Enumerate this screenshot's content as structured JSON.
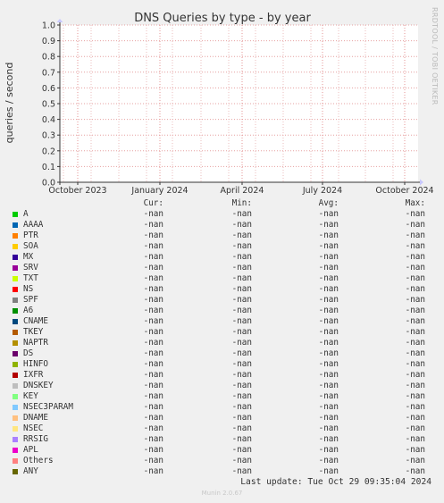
{
  "side_label": "RRDTOOL / TOBI OETIKER",
  "chart_data": {
    "type": "line",
    "title": "DNS Queries by type - by year",
    "ylabel": "queries / second",
    "xlabel": "",
    "ylim": [
      0,
      1
    ],
    "y_ticks": [
      "0.0",
      "0.1",
      "0.2",
      "0.3",
      "0.4",
      "0.5",
      "0.6",
      "0.7",
      "0.8",
      "0.9",
      "1.0"
    ],
    "x_ticks": [
      "October 2023",
      "January 2024",
      "April 2024",
      "July 2024",
      "October 2024"
    ],
    "grid": true,
    "series": []
  },
  "legend": {
    "headers": {
      "cur": "Cur:",
      "min": "Min:",
      "avg": "Avg:",
      "max": "Max:"
    },
    "rows": [
      {
        "name": "A",
        "color": "#00cc00",
        "cur": "-nan",
        "min": "-nan",
        "avg": "-nan",
        "max": "-nan"
      },
      {
        "name": "AAAA",
        "color": "#0066b3",
        "cur": "-nan",
        "min": "-nan",
        "avg": "-nan",
        "max": "-nan"
      },
      {
        "name": "PTR",
        "color": "#ff8000",
        "cur": "-nan",
        "min": "-nan",
        "avg": "-nan",
        "max": "-nan"
      },
      {
        "name": "SOA",
        "color": "#ffcc00",
        "cur": "-nan",
        "min": "-nan",
        "avg": "-nan",
        "max": "-nan"
      },
      {
        "name": "MX",
        "color": "#330099",
        "cur": "-nan",
        "min": "-nan",
        "avg": "-nan",
        "max": "-nan"
      },
      {
        "name": "SRV",
        "color": "#990099",
        "cur": "-nan",
        "min": "-nan",
        "avg": "-nan",
        "max": "-nan"
      },
      {
        "name": "TXT",
        "color": "#ccff00",
        "cur": "-nan",
        "min": "-nan",
        "avg": "-nan",
        "max": "-nan"
      },
      {
        "name": "NS",
        "color": "#ff0000",
        "cur": "-nan",
        "min": "-nan",
        "avg": "-nan",
        "max": "-nan"
      },
      {
        "name": "SPF",
        "color": "#808080",
        "cur": "-nan",
        "min": "-nan",
        "avg": "-nan",
        "max": "-nan"
      },
      {
        "name": "A6",
        "color": "#008f00",
        "cur": "-nan",
        "min": "-nan",
        "avg": "-nan",
        "max": "-nan"
      },
      {
        "name": "CNAME",
        "color": "#00487d",
        "cur": "-nan",
        "min": "-nan",
        "avg": "-nan",
        "max": "-nan"
      },
      {
        "name": "TKEY",
        "color": "#b35a00",
        "cur": "-nan",
        "min": "-nan",
        "avg": "-nan",
        "max": "-nan"
      },
      {
        "name": "NAPTR",
        "color": "#b38f00",
        "cur": "-nan",
        "min": "-nan",
        "avg": "-nan",
        "max": "-nan"
      },
      {
        "name": "DS",
        "color": "#6b006b",
        "cur": "-nan",
        "min": "-nan",
        "avg": "-nan",
        "max": "-nan"
      },
      {
        "name": "HINFO",
        "color": "#8fb300",
        "cur": "-nan",
        "min": "-nan",
        "avg": "-nan",
        "max": "-nan"
      },
      {
        "name": "IXFR",
        "color": "#b30000",
        "cur": "-nan",
        "min": "-nan",
        "avg": "-nan",
        "max": "-nan"
      },
      {
        "name": "DNSKEY",
        "color": "#bebebe",
        "cur": "-nan",
        "min": "-nan",
        "avg": "-nan",
        "max": "-nan"
      },
      {
        "name": "KEY",
        "color": "#80ff80",
        "cur": "-nan",
        "min": "-nan",
        "avg": "-nan",
        "max": "-nan"
      },
      {
        "name": "NSEC3PARAM",
        "color": "#80c9ff",
        "cur": "-nan",
        "min": "-nan",
        "avg": "-nan",
        "max": "-nan"
      },
      {
        "name": "DNAME",
        "color": "#ffc080",
        "cur": "-nan",
        "min": "-nan",
        "avg": "-nan",
        "max": "-nan"
      },
      {
        "name": "NSEC",
        "color": "#ffe680",
        "cur": "-nan",
        "min": "-nan",
        "avg": "-nan",
        "max": "-nan"
      },
      {
        "name": "RRSIG",
        "color": "#aa80ff",
        "cur": "-nan",
        "min": "-nan",
        "avg": "-nan",
        "max": "-nan"
      },
      {
        "name": "APL",
        "color": "#ee00cc",
        "cur": "-nan",
        "min": "-nan",
        "avg": "-nan",
        "max": "-nan"
      },
      {
        "name": "Others",
        "color": "#ff8080",
        "cur": "-nan",
        "min": "-nan",
        "avg": "-nan",
        "max": "-nan"
      },
      {
        "name": "ANY",
        "color": "#666600",
        "cur": "-nan",
        "min": "-nan",
        "avg": "-nan",
        "max": "-nan"
      }
    ]
  },
  "last_update": "Last update: Tue Oct 29 09:35:04 2024",
  "footer": "Munin 2.0.67"
}
